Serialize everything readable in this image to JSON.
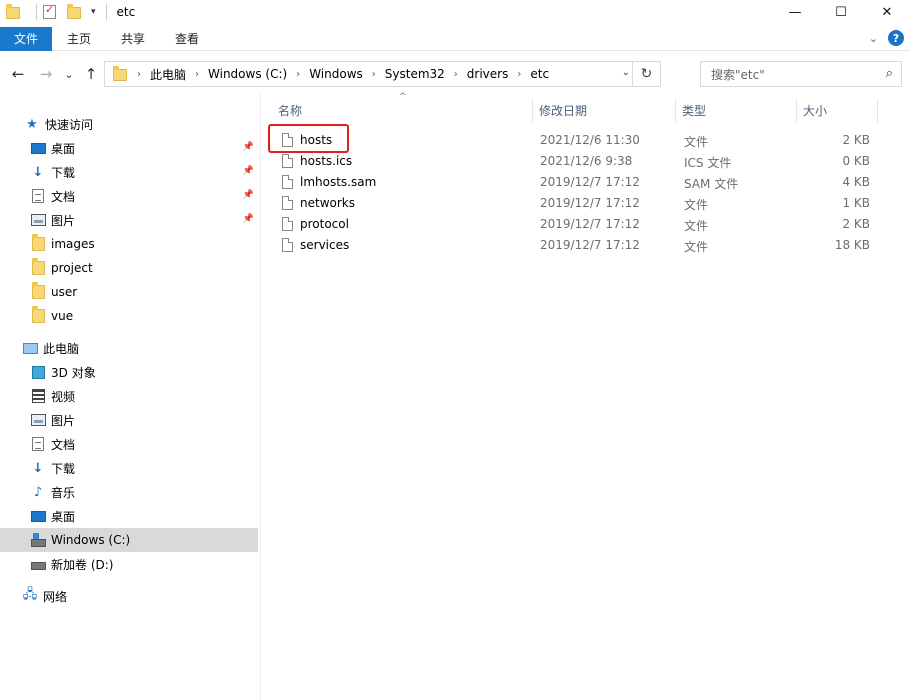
{
  "window": {
    "title": "etc",
    "minimize": "—",
    "maximize": "☐",
    "close": "✕"
  },
  "ribbon": {
    "tabs": [
      "文件",
      "主页",
      "共享",
      "查看"
    ],
    "help": "?"
  },
  "nav": {
    "back": "←",
    "forward": "→",
    "recent": "⌄",
    "up": "↑",
    "breadcrumb": [
      "此电脑",
      "Windows (C:)",
      "Windows",
      "System32",
      "drivers",
      "etc"
    ],
    "search_placeholder": "搜索\"etc\""
  },
  "sidebar": {
    "quick_access": "快速访问",
    "quick_items": [
      {
        "label": "桌面",
        "icon": "desktop-icon",
        "pinned": true
      },
      {
        "label": "下载",
        "icon": "download-icon",
        "pinned": true
      },
      {
        "label": "文档",
        "icon": "documents-icon",
        "pinned": true
      },
      {
        "label": "图片",
        "icon": "pictures-icon",
        "pinned": true
      },
      {
        "label": "images",
        "icon": "folder-icon",
        "pinned": false
      },
      {
        "label": "project",
        "icon": "folder-icon",
        "pinned": false
      },
      {
        "label": "user",
        "icon": "folder-icon",
        "pinned": false
      },
      {
        "label": "vue",
        "icon": "folder-icon",
        "pinned": false
      }
    ],
    "this_pc": "此电脑",
    "pc_items": [
      {
        "label": "3D 对象",
        "icon": "3d-objects-icon"
      },
      {
        "label": "视频",
        "icon": "videos-icon"
      },
      {
        "label": "图片",
        "icon": "pictures-icon"
      },
      {
        "label": "文档",
        "icon": "documents-icon"
      },
      {
        "label": "下载",
        "icon": "download-icon"
      },
      {
        "label": "音乐",
        "icon": "music-icon"
      },
      {
        "label": "桌面",
        "icon": "desktop-icon"
      },
      {
        "label": "Windows (C:)",
        "icon": "system-drive-icon",
        "selected": true
      },
      {
        "label": "新加卷 (D:)",
        "icon": "drive-icon"
      }
    ],
    "network": "网络"
  },
  "columns": {
    "name": "名称",
    "date": "修改日期",
    "type": "类型",
    "size": "大小"
  },
  "files": [
    {
      "name": "hosts",
      "date": "2021/12/6 11:30",
      "type": "文件",
      "size": "2 KB"
    },
    {
      "name": "hosts.ics",
      "date": "2021/12/6 9:38",
      "type": "ICS 文件",
      "size": "0 KB"
    },
    {
      "name": "lmhosts.sam",
      "date": "2019/12/7 17:12",
      "type": "SAM 文件",
      "size": "4 KB"
    },
    {
      "name": "networks",
      "date": "2019/12/7 17:12",
      "type": "文件",
      "size": "1 KB"
    },
    {
      "name": "protocol",
      "date": "2019/12/7 17:12",
      "type": "文件",
      "size": "2 KB"
    },
    {
      "name": "services",
      "date": "2019/12/7 17:12",
      "type": "文件",
      "size": "18 KB"
    }
  ],
  "colors": {
    "file_tab": "#1979ca",
    "highlight": "#e02020",
    "selection": "#d9d9d9"
  }
}
